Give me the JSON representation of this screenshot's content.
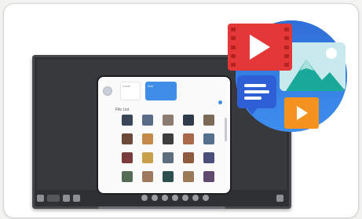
{
  "tablet": {
    "header_tile_1": "Local",
    "header_tile_2": "Add",
    "file_section": "File List"
  },
  "thumbnails": [
    "#3a4656",
    "#5a6b86",
    "#8c7b6f",
    "#2f3a4a",
    "#7a6a55",
    "#6b4a3a",
    "#c58a4a",
    "#3e3e3e",
    "#a86a4a",
    "#55708f",
    "#7a3b3b",
    "#c9a14a",
    "#5c6d7d",
    "#8e5b40",
    "#4a4f7a",
    "#556b55",
    "#a07a60",
    "#2f4f4f",
    "#9b7a5a",
    "#604a70"
  ],
  "icons": {
    "video": "play-icon",
    "image": "mountain-icon",
    "message": "chat-icon",
    "media": "orange-play-icon"
  },
  "colors": {
    "accent_blue": "#3e8ee8",
    "video_red": "#e43737",
    "chat_blue": "#2f5fd6",
    "orange": "#f3921f"
  }
}
